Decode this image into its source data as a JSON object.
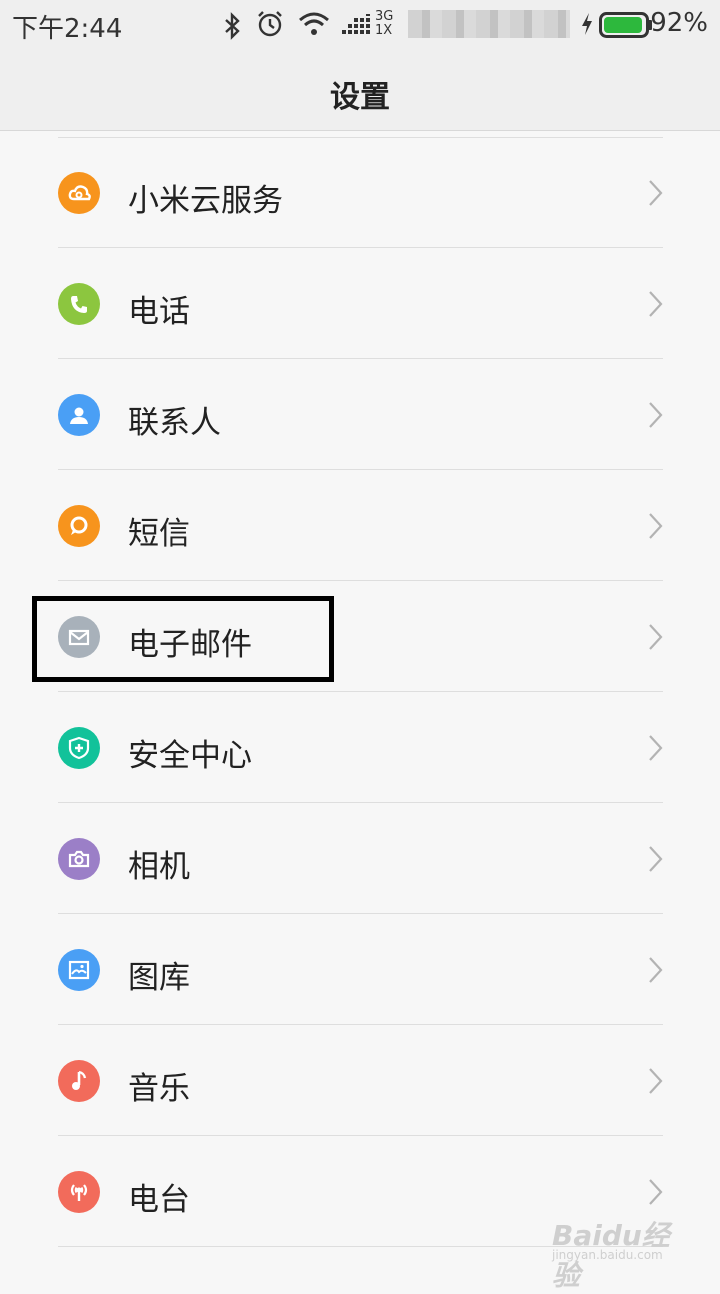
{
  "status_bar": {
    "time": "下午2:44",
    "network": "3G",
    "network2": "1X",
    "battery_percent": "92%",
    "battery_level": 0.92,
    "icons": [
      "bluetooth-icon",
      "alarm-icon",
      "wifi-icon",
      "signal-icon",
      "charging-icon",
      "battery-icon"
    ]
  },
  "header": {
    "title": "设置"
  },
  "settings_items": [
    {
      "label": "小米云服务",
      "icon": "cloud-icon",
      "color": "#f7941d"
    },
    {
      "label": "电话",
      "icon": "phone-icon",
      "color": "#8cc63f"
    },
    {
      "label": "联系人",
      "icon": "contact-icon",
      "color": "#4a9ff5"
    },
    {
      "label": "短信",
      "icon": "message-icon",
      "color": "#f7941d"
    },
    {
      "label": "电子邮件",
      "icon": "mail-icon",
      "color": "#a8b1ba"
    },
    {
      "label": "安全中心",
      "icon": "shield-icon",
      "color": "#12c29a"
    },
    {
      "label": "相机",
      "icon": "camera-icon",
      "color": "#9b7fc7"
    },
    {
      "label": "图库",
      "icon": "gallery-icon",
      "color": "#4a9ff5"
    },
    {
      "label": "音乐",
      "icon": "music-icon",
      "color": "#f26b5b"
    },
    {
      "label": "电台",
      "icon": "radio-icon",
      "color": "#f26b5b"
    }
  ],
  "watermark": {
    "main": "Baidu经验",
    "sub": "jingyan.baidu.com"
  }
}
